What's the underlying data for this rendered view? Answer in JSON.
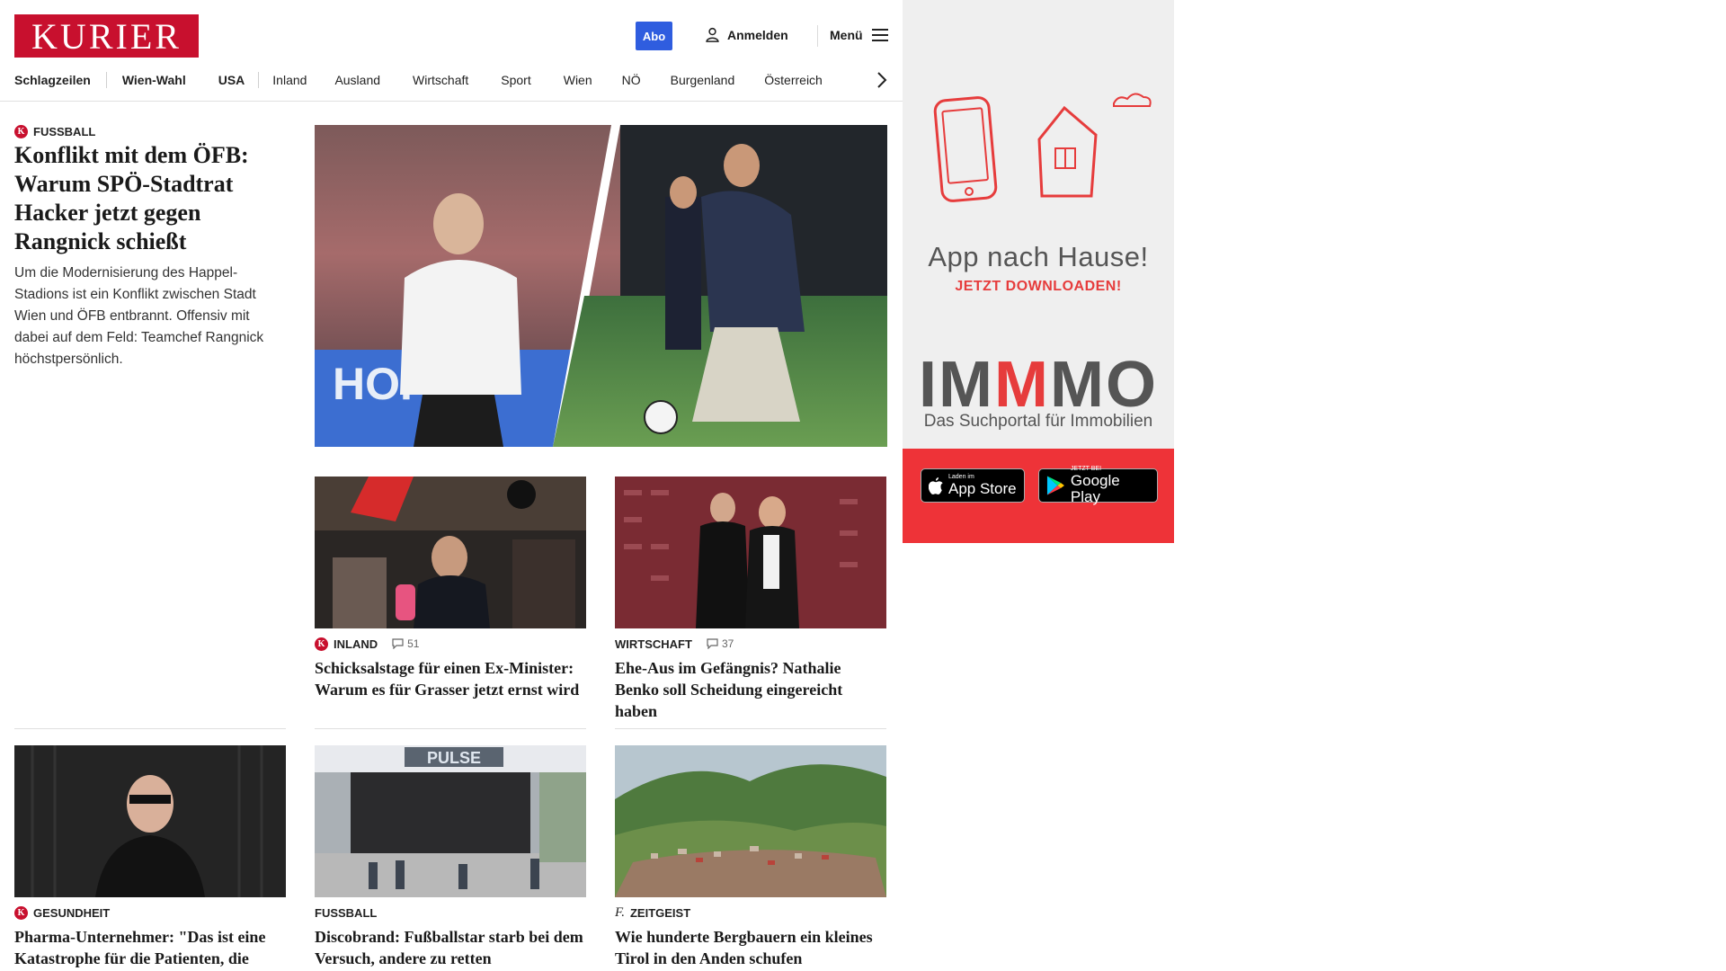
{
  "header": {
    "logo": "KURIER",
    "abo": "Abo",
    "login": "Anmelden",
    "menu": "Menü"
  },
  "nav": {
    "items": [
      "Schlagzeilen",
      "Wien-Wahl",
      "USA",
      "Inland",
      "Ausland",
      "Wirtschaft",
      "Sport",
      "Wien",
      "NÖ",
      "Burgenland",
      "Österreich"
    ]
  },
  "lead": {
    "category": "Fussball",
    "title": "Konflikt mit dem ÖFB: Warum SPÖ-Stadtrat Hacker jetzt gegen Rangnick schießt",
    "teaser": "Um die Modernisierung des Happel-Stadions ist ein Konflikt zwischen Stadt Wien und ÖFB entbrannt. Offensiv mit dabei auf dem Feld: Teamchef Rangnick höchstpersönlich."
  },
  "cards": [
    {
      "category": "Inland",
      "comments": "51",
      "title": "Schicksalstage für einen Ex-Minister: Warum es für Grasser jetzt ernst wird"
    },
    {
      "category": "Wirtschaft",
      "comments": "37",
      "title": "Ehe-Aus im Gefängnis? Nathalie Benko soll Scheidung eingereicht haben"
    },
    {
      "category": "Gesundheit",
      "title": "Pharma-Unternehmer: \"Das ist eine Katastrophe für die Patienten, die leiden\""
    },
    {
      "category": "Fussball",
      "title": "Discobrand: Fußballstar starb bei dem Versuch, andere zu retten"
    },
    {
      "category": "Zeitgeist",
      "title": "Wie hunderte Bergbauern ein kleines Tirol in den Anden schufen"
    }
  ],
  "ad": {
    "title": "App nach Hause!",
    "subtitle": "JETZT DOWNLOADEN!",
    "brand_left": "IM",
    "brand_mid": "M",
    "brand_right": "MO",
    "brand_sub": "Das Suchportal für Immobilien",
    "appstore_small": "Laden im",
    "appstore_big": "App Store",
    "googleplay_small": "JETZT BEI",
    "googleplay_big": "Google Play"
  },
  "colors": {
    "brand": "#c8102e",
    "abo": "#2f5ddf",
    "ad_red": "#ee3338"
  },
  "icons": [
    "user-icon",
    "menu-icon",
    "chevron-right-icon",
    "comment-icon",
    "apple-icon",
    "play-icon"
  ]
}
